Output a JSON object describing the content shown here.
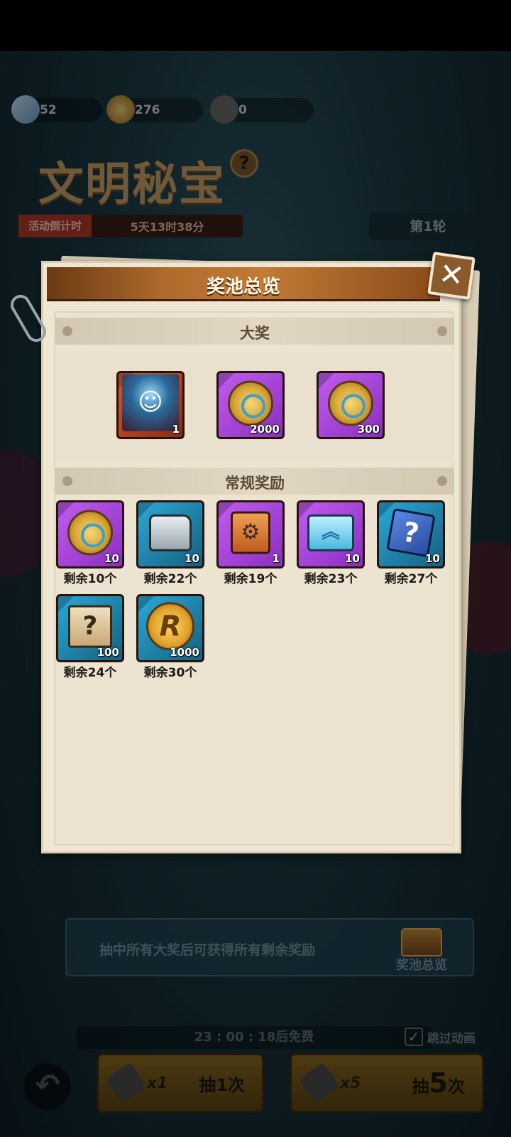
{
  "background": {
    "resources": [
      {
        "icon": "crystal-icon",
        "value": "52"
      },
      {
        "icon": "gear-coin-icon",
        "value": "276"
      },
      {
        "icon": "flashlight-icon",
        "value": "0"
      }
    ],
    "event_title": "文明秘宝",
    "countdown_label": "活动倒计时",
    "countdown_value": "5天13时38分",
    "round_label": "第1轮",
    "notice_text": "抽中所有大奖后可获得所有剩余奖励",
    "pool_button_label": "奖池总览",
    "free_timer": "23 : 00 : 18后免费",
    "skip_animation_label": "跳过动画",
    "draw_one": {
      "multiplier": "x1",
      "prefix": "抽",
      "count": "1",
      "suffix": "次"
    },
    "draw_five": {
      "multiplier": "x5",
      "prefix": "抽",
      "count": "5",
      "suffix": "次"
    }
  },
  "modal": {
    "title": "奖池总览",
    "grand_section_title": "大奖",
    "grand_prizes": [
      {
        "icon": "hero-character-icon",
        "count": "1",
        "rarity": "red"
      },
      {
        "icon": "gear-coin-icon",
        "count": "2000",
        "rarity": "purple"
      },
      {
        "icon": "gear-coin-icon",
        "count": "300",
        "rarity": "purple"
      }
    ],
    "regular_section_title": "常规奖励",
    "regular_rewards": [
      {
        "icon": "gear-coin-icon",
        "count": "10",
        "rarity": "purple",
        "remaining": "剩余10个"
      },
      {
        "icon": "ore-icon",
        "count": "10",
        "rarity": "blue",
        "remaining": "剩余22个"
      },
      {
        "icon": "mech-fragment-icon",
        "count": "1",
        "rarity": "purple",
        "remaining": "剩余19个"
      },
      {
        "icon": "upgrade-card-icon",
        "count": "10",
        "rarity": "purple",
        "remaining": "剩余23个"
      },
      {
        "icon": "mystery-cube-icon",
        "count": "10",
        "rarity": "blue",
        "remaining": "剩余27个"
      },
      {
        "icon": "mystery-map-icon",
        "count": "100",
        "rarity": "blue",
        "remaining": "剩余24个"
      },
      {
        "icon": "r-coin-icon",
        "count": "1000",
        "rarity": "blue",
        "remaining": "剩余30个"
      }
    ]
  },
  "colors": {
    "header_brown": "#b06a2c",
    "paper": "#efe6d4",
    "rarity_purple": "#c15cf0",
    "rarity_blue": "#2aa8d8",
    "rarity_red": "#e0542a"
  }
}
